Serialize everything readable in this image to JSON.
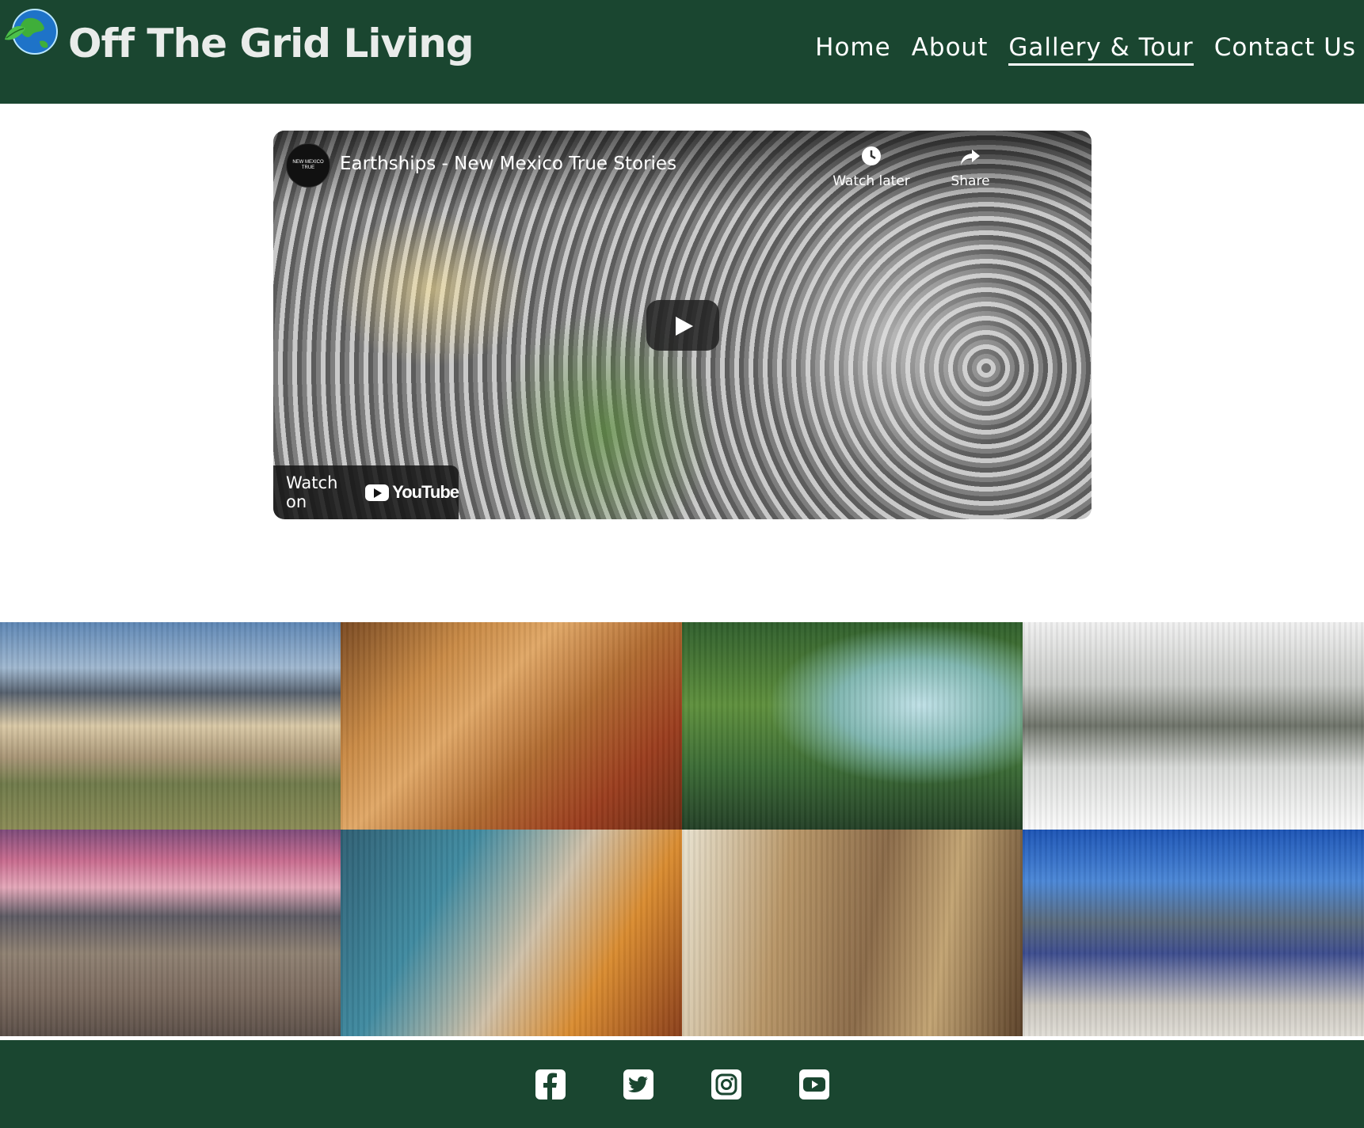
{
  "header": {
    "brand": "Off The Grid Living",
    "logo_icon": "globe-leaf-icon",
    "nav": [
      {
        "label": "Home",
        "active": false
      },
      {
        "label": "About",
        "active": false
      },
      {
        "label": "Gallery & Tour",
        "active": true
      },
      {
        "label": "Contact Us",
        "active": false
      }
    ]
  },
  "video": {
    "title": "Earthships - New Mexico True Stories",
    "channel_avatar_text": "NEW MEXICO TRUE",
    "watch_later_label": "Watch later",
    "share_label": "Share",
    "watch_on_label": "Watch on",
    "youtube_label": "YouTube",
    "play_icon": "play-icon"
  },
  "gallery": {
    "tiles": [
      {
        "name": "earthship-desert-mountains"
      },
      {
        "name": "earthship-kitchen"
      },
      {
        "name": "earthship-greenhouse-atrium"
      },
      {
        "name": "earthship-snow-forest"
      },
      {
        "name": "earthship-sunset-mesa"
      },
      {
        "name": "earthship-bathroom"
      },
      {
        "name": "earthship-dining-room"
      },
      {
        "name": "earthship-solar-panels"
      }
    ]
  },
  "footer": {
    "social": [
      "facebook-icon",
      "twitter-icon",
      "instagram-icon",
      "youtube-icon"
    ]
  },
  "colors": {
    "brand_green": "#1a4630",
    "text_light": "#ffffff"
  }
}
